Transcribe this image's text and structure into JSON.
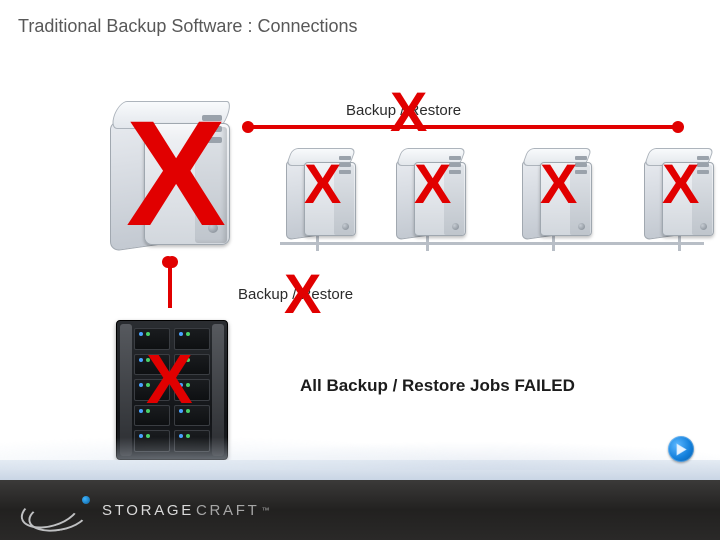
{
  "title": "Traditional Backup Software : Connections",
  "labels": {
    "top_link": "Backup / Restore",
    "side_link": "Backup / Restore"
  },
  "status": {
    "fail_text": "All Backup / Restore Jobs FAILED"
  },
  "brand": {
    "name1": "STORAGE",
    "name2": "CRAFT",
    "tm": "™"
  },
  "fail_marks": [
    "X",
    "X",
    "X",
    "X",
    "X",
    "X",
    "X",
    "X"
  ],
  "colors": {
    "x": "#e10000",
    "bar": "#e10000"
  }
}
